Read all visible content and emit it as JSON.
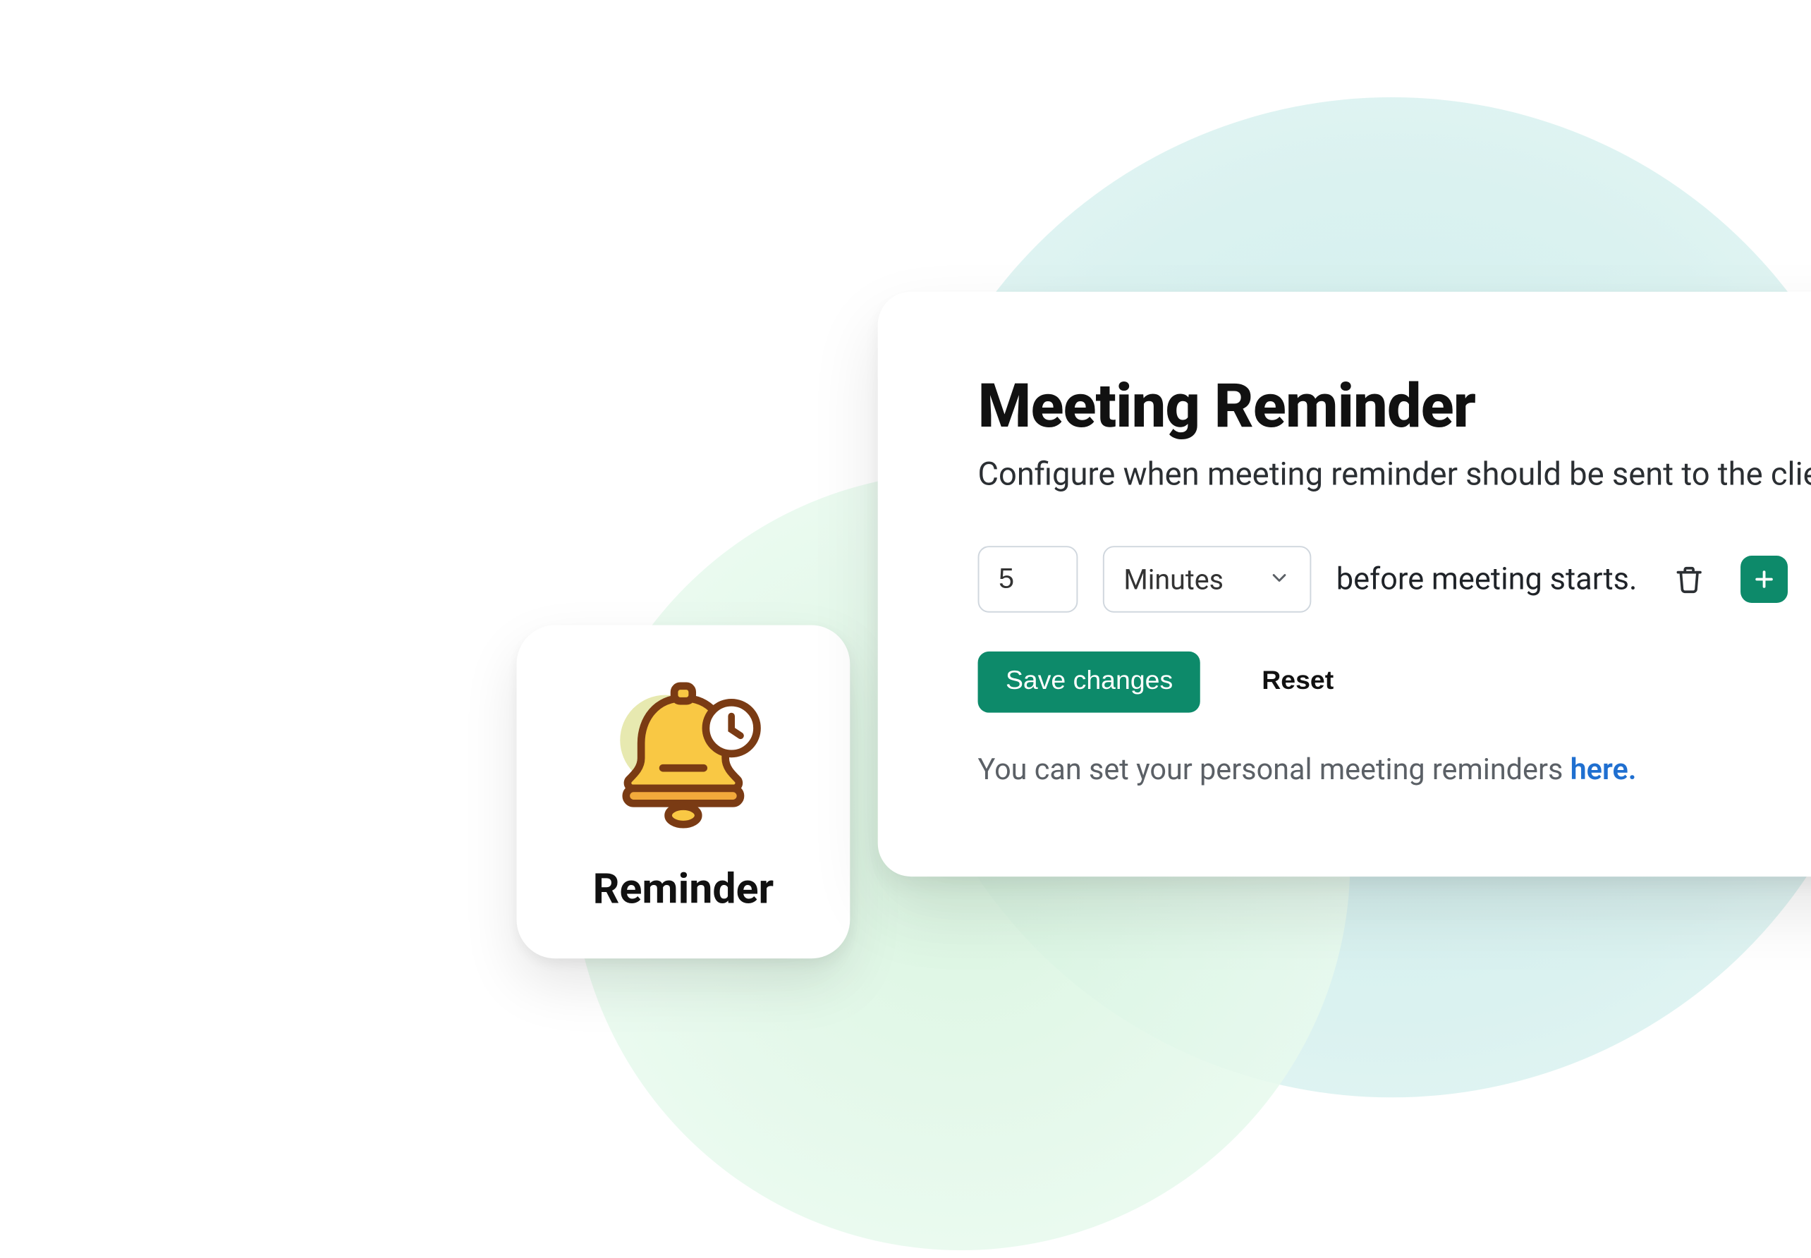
{
  "reminder_badge": {
    "label": "Reminder"
  },
  "settings": {
    "title": "Meeting Reminder",
    "subtitle": "Configure when meeting reminder should be sent to the client",
    "value": "5",
    "unit_selected": "Minutes",
    "trailing_text": "before meeting starts.",
    "save_label": "Save changes",
    "reset_label": "Reset",
    "hint_prefix": "You can set your personal meeting reminders ",
    "hint_link": "here."
  },
  "colors": {
    "accent": "#0d8a6a",
    "link": "#1f6fd0"
  }
}
